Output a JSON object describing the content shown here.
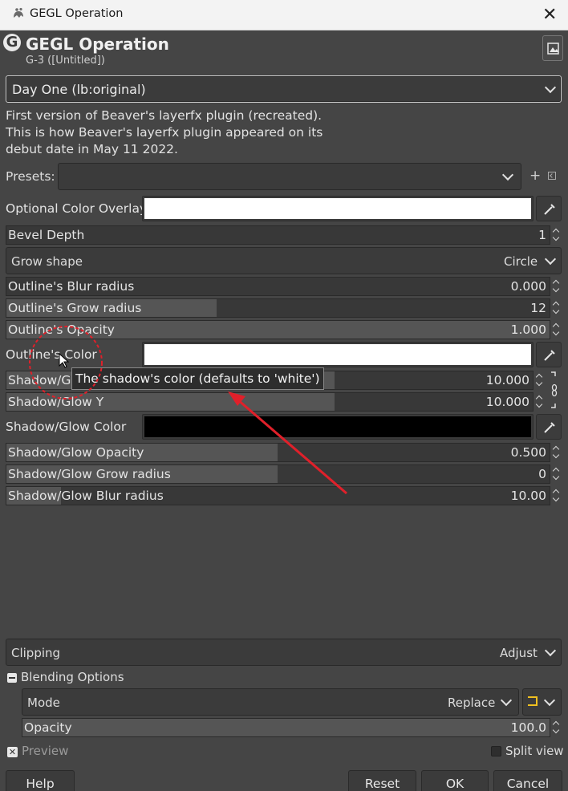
{
  "window": {
    "title": "GEGL Operation",
    "app_icon": "gimp-wilber-icon"
  },
  "header": {
    "title": "GEGL Operation",
    "subtitle": "G-3 ([Untitled])",
    "logo_icon": "gegl-logo-icon"
  },
  "operation": {
    "selected": "Day One (lb:original)"
  },
  "description": [
    "First version of Beaver's layerfx plugin (recreated).",
    "This is how Beaver's layerfx plugin appeared on its",
    "debut date in May 11 2022."
  ],
  "presets": {
    "label": "Presets:",
    "value": ""
  },
  "params": {
    "color_overlay": {
      "label": "Optional Color Overlay",
      "color": "#ffffff"
    },
    "bevel_depth": {
      "label": "Bevel Depth",
      "value": "1"
    },
    "grow_shape": {
      "label": "Grow shape",
      "value": "Circle"
    },
    "outline_blur": {
      "label": "Outline's Blur radius",
      "value": "0.000"
    },
    "outline_grow": {
      "label": "Outline's Grow radius",
      "value": "12"
    },
    "outline_opacity": {
      "label": "Outline's Opacity",
      "value": "1.000"
    },
    "outline_color": {
      "label": "Outline's Color",
      "color": "#ffffff"
    },
    "shadow_x": {
      "label": "Shadow/Glow X",
      "value": "10.000"
    },
    "shadow_y": {
      "label": "Shadow/Glow Y",
      "value": "10.000"
    },
    "shadow_color": {
      "label": "Shadow/Glow Color",
      "color": "#000000"
    },
    "shadow_opacity": {
      "label": "Shadow/Glow Opacity",
      "value": "0.500"
    },
    "shadow_grow": {
      "label": "Shadow/Glow Grow radius",
      "value": "0"
    },
    "shadow_blur": {
      "label": "Shadow/Glow Blur radius",
      "value": "10.00"
    }
  },
  "tooltip": {
    "text": "The shadow's color (defaults to 'white')"
  },
  "clipping": {
    "label": "Clipping",
    "value": "Adjust"
  },
  "blending": {
    "header": "Blending Options",
    "mode_label": "Mode",
    "mode_value": "Replace",
    "opacity_label": "Opacity",
    "opacity_value": "100.0"
  },
  "preview": {
    "label": "Preview",
    "checked": true
  },
  "split_view": {
    "label": "Split view",
    "checked": false
  },
  "buttons": {
    "help": "Help",
    "reset": "Reset",
    "ok": "OK",
    "cancel": "Cancel"
  },
  "annotation": {
    "color": "#e0202a"
  }
}
